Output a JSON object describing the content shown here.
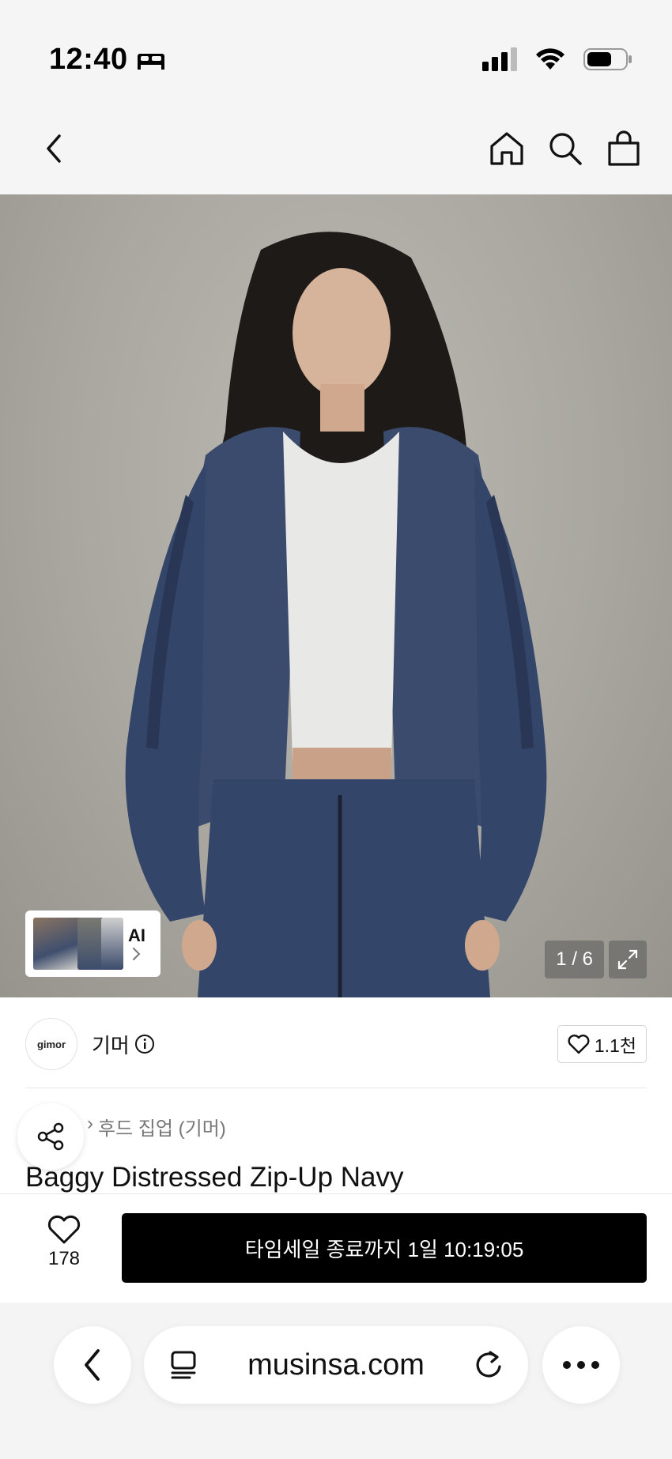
{
  "status_bar": {
    "time": "12:40",
    "sleep_icon": "bed-icon",
    "signal_icon": "cellular-signal-icon",
    "wifi_icon": "wifi-icon",
    "battery_icon": "battery-icon"
  },
  "nav": {
    "back_icon": "chevron-left-icon",
    "home_icon": "home-icon",
    "search_icon": "search-icon",
    "cart_icon": "shopping-bag-icon"
  },
  "hero": {
    "ai_label": "AI",
    "image_counter": "1 / 6",
    "expand_icon": "expand-icon"
  },
  "brand": {
    "logo_text": "gimor",
    "name": "기머",
    "likes": "1.1천"
  },
  "breadcrumb": {
    "category": "후드 집업 (기머)"
  },
  "product": {
    "title": "Baggy Distressed Zip-Up Navy"
  },
  "purchase": {
    "wish_count": "178",
    "cta_label": "타임세일 종료까지 1일 10:19:05"
  },
  "browser": {
    "url": "musinsa.com",
    "back_icon": "chevron-left-icon",
    "tabs_icon": "reader-icon",
    "reload_icon": "reload-icon",
    "more_icon": "more-icon"
  },
  "colors": {
    "cta_background": "#000000",
    "page_background": "#f5f5f5"
  }
}
